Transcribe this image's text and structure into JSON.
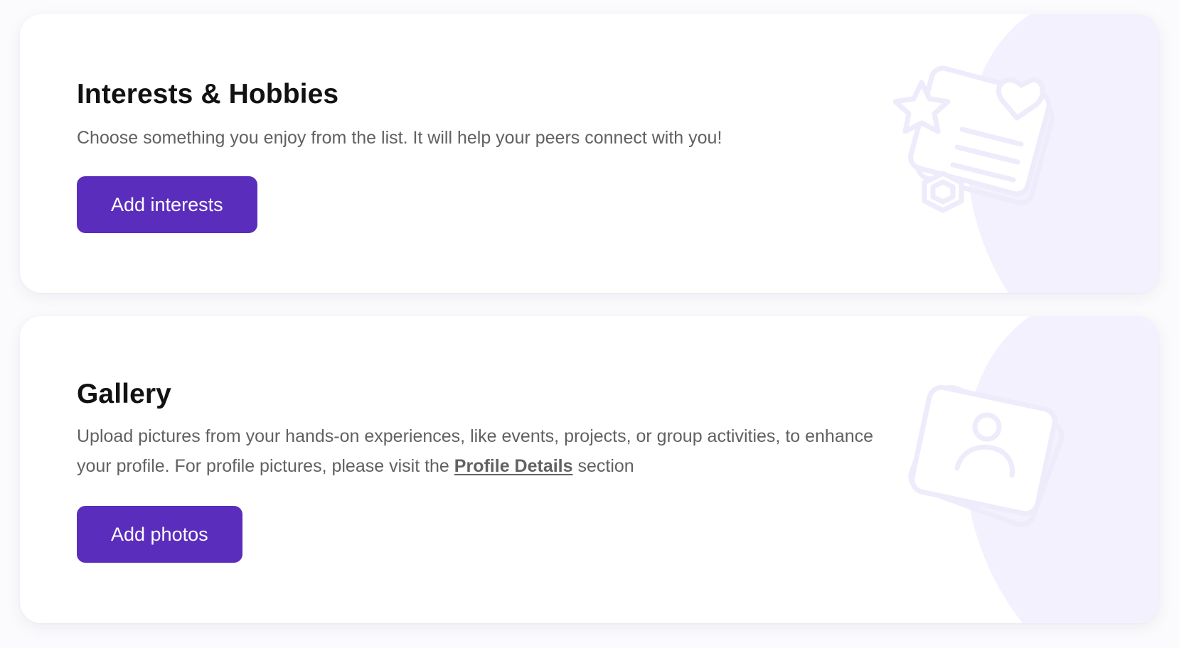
{
  "interests": {
    "title": "Interests & Hobbies",
    "description": "Choose something you enjoy from the list. It will help your peers connect with you!",
    "button_label": "Add interests",
    "illustration_icon": "interests-cards-icon"
  },
  "gallery": {
    "title": "Gallery",
    "description_before_link": "Upload pictures from your hands-on experiences, like events, projects, or group activities, to enhance your profile. For profile pictures, please visit the ",
    "link_label": "Profile Details",
    "description_after_link": " section",
    "button_label": "Add photos",
    "illustration_icon": "photo-cards-icon"
  },
  "colors": {
    "accent": "#5b2dbd",
    "illustration": "#eeebfb",
    "illustration_blob": "#f4f1fe"
  }
}
